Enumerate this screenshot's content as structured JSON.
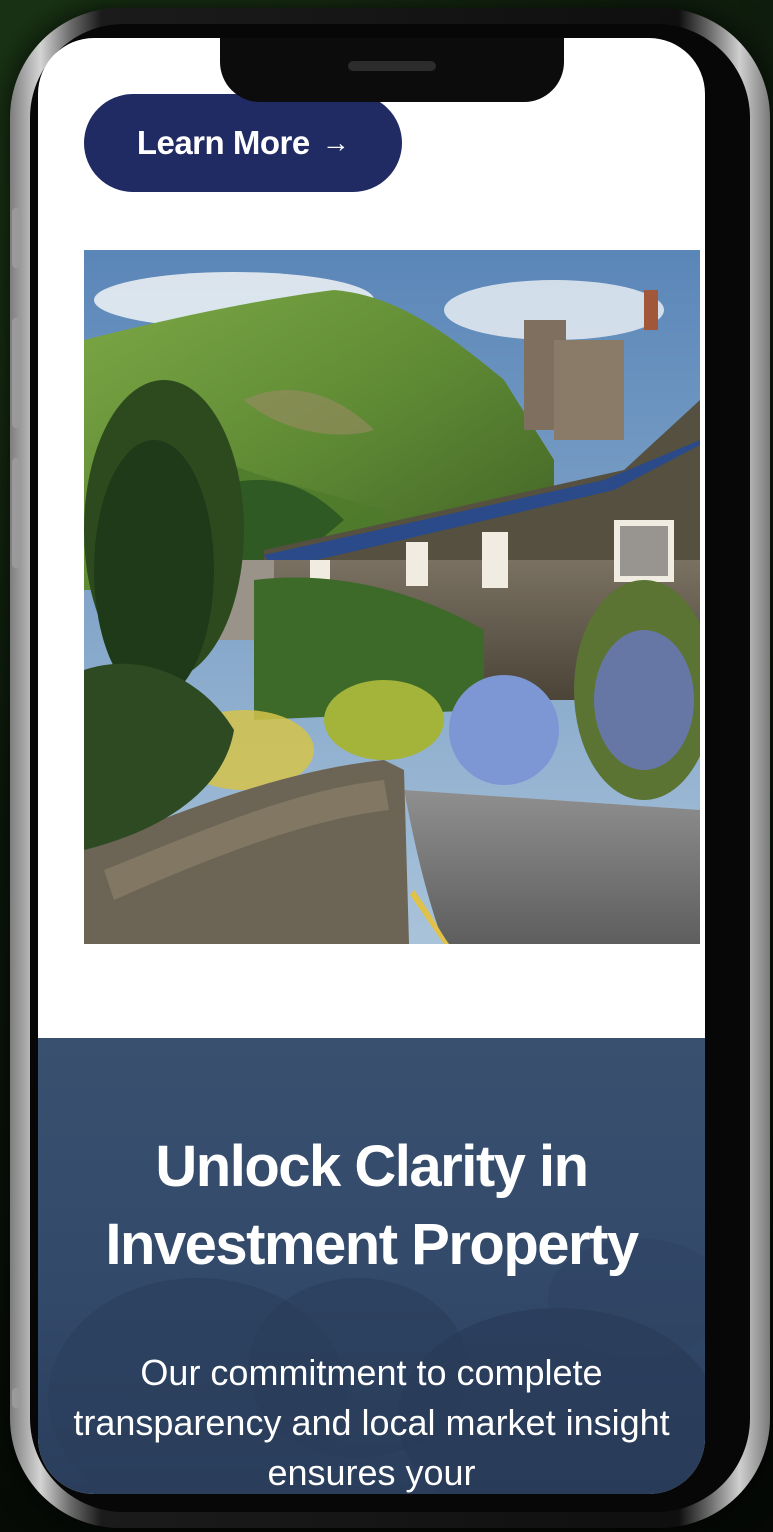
{
  "cta": {
    "label": "Learn More",
    "arrow": "→"
  },
  "photo": {
    "subject": "stone cottage village with hills"
  },
  "hero": {
    "title_line1": "Unlock Clarity in",
    "title_line2": "Investment Property",
    "body": "Our commitment to complete transparency and local market insight ensures your"
  },
  "colors": {
    "button_bg": "#202a63",
    "hero_bg": "#33496a",
    "screen_bg": "#ffffff"
  }
}
